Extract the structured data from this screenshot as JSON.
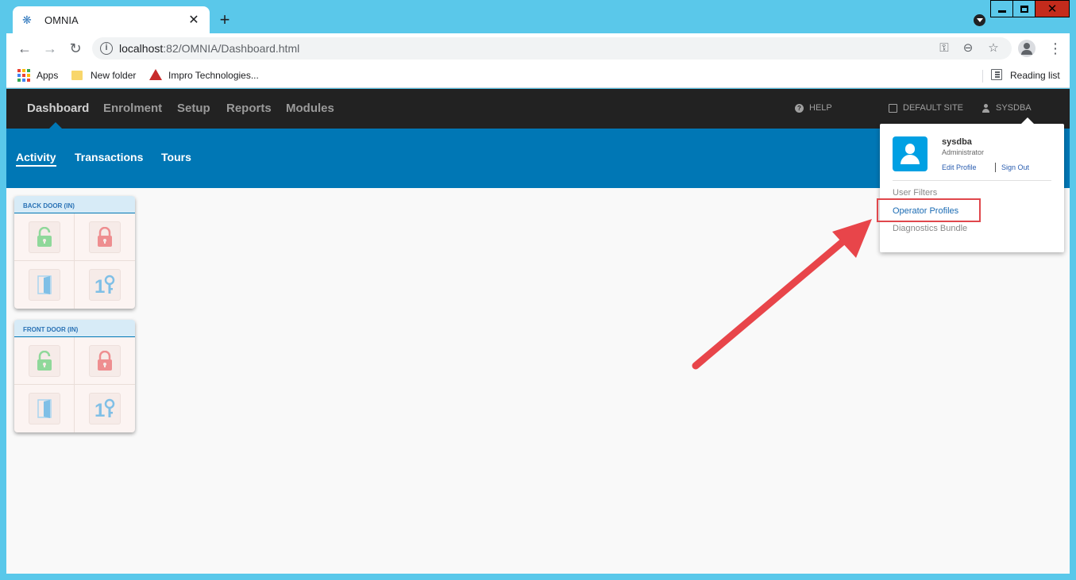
{
  "browser": {
    "tab_title": "OMNIA",
    "tab_close": "✕",
    "new_tab": "+",
    "url_host": "localhost",
    "url_path": ":82/OMNIA/Dashboard.html",
    "bookmarks": [
      {
        "label": "Apps",
        "icon": "apps-grid-icon"
      },
      {
        "label": "New folder",
        "icon": "folder-icon"
      },
      {
        "label": "Impro Technologies...",
        "icon": "impro-logo-icon"
      }
    ],
    "reading_list": "Reading list"
  },
  "topnav": {
    "items": [
      "Dashboard",
      "Enrolment",
      "Setup",
      "Reports",
      "Modules"
    ],
    "help": "HELP",
    "site": "DEFAULT SITE",
    "user": "SYSDBA"
  },
  "subnav": {
    "items": [
      "Activity",
      "Transactions",
      "Tours"
    ]
  },
  "doors": [
    {
      "name": "BACK DOOR (IN)"
    },
    {
      "name": "FRONT DOOR (IN)"
    }
  ],
  "dropdown": {
    "username": "sysdba",
    "role": "Administrator",
    "edit_profile": "Edit Profile",
    "sign_out": "Sign Out",
    "items": [
      "User Filters",
      "Operator Profiles",
      "Diagnostics Bundle"
    ]
  },
  "colors": {
    "nav_bg": "#222222",
    "subnav_bg": "#0077b5",
    "accent": "#00a0e3",
    "annotation": "#e0474c"
  }
}
